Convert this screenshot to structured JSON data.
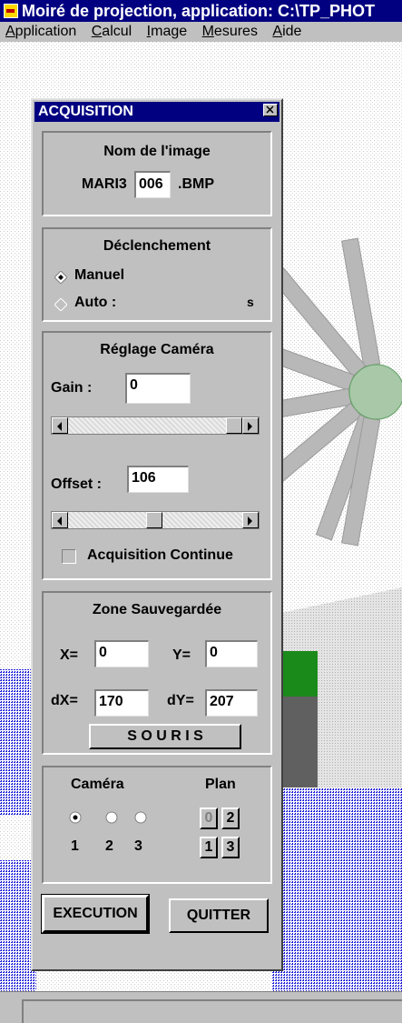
{
  "window": {
    "title": "Moiré de projection, application: C:\\TP_PHOT"
  },
  "menu": [
    "Application",
    "Calcul",
    "Image",
    "Mesures",
    "Aide"
  ],
  "menu_access": [
    "A",
    "C",
    "I",
    "M",
    "A"
  ],
  "dialog": {
    "title": "ACQUISITION",
    "nom_image": {
      "title": "Nom de l'image",
      "prefix": "MARI3",
      "number": "006",
      "ext": ".BMP"
    },
    "declenchement": {
      "title": "Déclenchement",
      "manuel": "Manuel",
      "auto": "Auto :",
      "unit": "s",
      "selected": "Manuel"
    },
    "reglage": {
      "title": "Réglage Caméra",
      "gain_label": "Gain :",
      "gain": "0",
      "offset_label": "Offset :",
      "offset": "106",
      "continue_label": "Acquisition Continue",
      "continue_checked": false
    },
    "zone": {
      "title": "Zone Sauvegardée",
      "x_label": "X=",
      "x": "0",
      "y_label": "Y=",
      "y": "0",
      "dx_label": "dX=",
      "dx": "170",
      "dy_label": "dY=",
      "dy": "207",
      "souris": "S O U R I S"
    },
    "camera": {
      "title": "Caméra",
      "options": [
        "1",
        "2",
        "3"
      ],
      "selected": "1"
    },
    "plan": {
      "title": "Plan",
      "buttons": [
        "0",
        "2",
        "1",
        "3"
      ]
    },
    "execution": "EXECUTION",
    "quitter": "QUITTER"
  }
}
